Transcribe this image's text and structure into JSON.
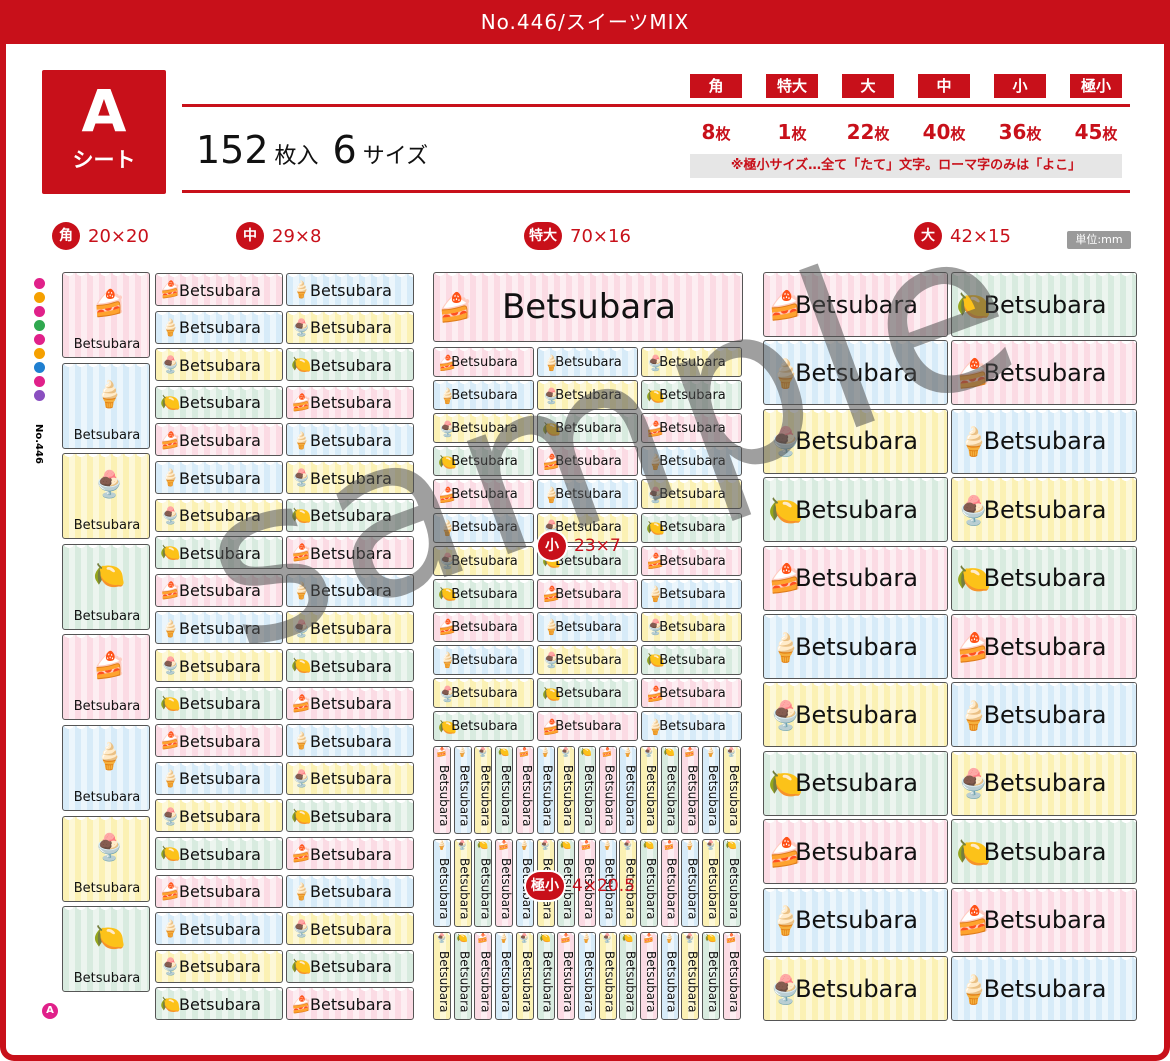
{
  "header": {
    "title": "No.446/スイーツMIX"
  },
  "sheet": {
    "letter": "A",
    "label": "シート"
  },
  "summary": {
    "count": "152",
    "count_unit": "枚入",
    "sizes": "6",
    "sizes_unit": "サイズ"
  },
  "sizes": [
    {
      "name": "角",
      "count": "8",
      "unit": "枚"
    },
    {
      "name": "特大",
      "count": "1",
      "unit": "枚"
    },
    {
      "name": "大",
      "count": "22",
      "unit": "枚"
    },
    {
      "name": "中",
      "count": "40",
      "unit": "枚"
    },
    {
      "name": "小",
      "count": "36",
      "unit": "枚"
    },
    {
      "name": "極小",
      "count": "45",
      "unit": "枚"
    }
  ],
  "note": "※極小サイズ…全て「たて」文字。ローマ字のみは「よこ」",
  "sections": {
    "kaku": {
      "badge": "角",
      "dim": "20×20"
    },
    "chu": {
      "badge": "中",
      "dim": "29×8"
    },
    "tokudai": {
      "badge": "特大",
      "dim": "70×16"
    },
    "dai": {
      "badge": "大",
      "dim": "42×15"
    },
    "sho": {
      "badge": "小",
      "dim": "23×7"
    },
    "gokusho": {
      "badge": "極小",
      "dim": "4×20.5"
    }
  },
  "unit_badge": "単位:mm",
  "brand_no": "No.446",
  "corner_mark": "A",
  "label_name": "Betsubara",
  "watermark": "sample",
  "colors": {
    "accent": "#c8101a",
    "pink": "#fbdbe4",
    "blue": "#d7ebf8",
    "yellow": "#fbf1b4",
    "green": "#d8ebdf"
  },
  "brand_dots": [
    "#e0218a",
    "#f5a000",
    "#e0218a",
    "#2fa84f",
    "#e0218a",
    "#f5a000",
    "#1f7fd0",
    "#e0218a",
    "#8a4fc0"
  ]
}
